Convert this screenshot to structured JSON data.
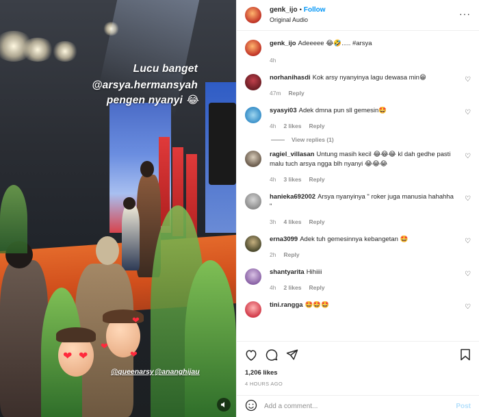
{
  "story": {
    "overlay_lines": [
      "Lucu banget",
      "@arsya.hermansyah",
      "pengen nyanyi"
    ],
    "overlay_emoji": "😂",
    "mentions": [
      "@queenarsy",
      "@ananghijau"
    ]
  },
  "header": {
    "username": "genk_ijo",
    "separator": "•",
    "follow_label": "Follow",
    "audio": "Original Audio",
    "more": "···"
  },
  "caption": {
    "username": "genk_ijo",
    "text": "Adeeeee 😂🤣..... #arsya",
    "time": "4h"
  },
  "comments": [
    {
      "username": "norhanihasdi",
      "text": "Kok arsy nyanyinya lagu dewasa min😁",
      "time": "47m",
      "likes": "",
      "reply": "Reply"
    },
    {
      "username": "syasyi03",
      "text": "Adek dmna pun sll gemesin🤩",
      "time": "4h",
      "likes": "2 likes",
      "reply": "Reply",
      "view_replies": "View replies (1)"
    },
    {
      "username": "ragiel_villasan",
      "text": "Untung masih kecil 😂😂😂 kl dah gedhe pasti malu tuch arsya ngga blh nyanyi 😂😂😂",
      "time": "4h",
      "likes": "3 likes",
      "reply": "Reply"
    },
    {
      "username": "hanieka692002",
      "text": "Arsya nyanyinya \" roker juga manusia hahahha \"",
      "time": "3h",
      "likes": "4 likes",
      "reply": "Reply"
    },
    {
      "username": "erna3099",
      "text": "Adek tuh gemesinnya kebangetan 🤩",
      "time": "2h",
      "likes": "",
      "reply": "Reply"
    },
    {
      "username": "shantyarita",
      "text": "Hihiiii",
      "time": "4h",
      "likes": "2 likes",
      "reply": "Reply"
    },
    {
      "username": "tini.rangga",
      "text": "🤩🤩🤩",
      "time": "",
      "likes": "",
      "reply": ""
    }
  ],
  "footer": {
    "likes": "1,206 likes",
    "time": "4 HOURS AGO",
    "placeholder": "Add a comment...",
    "post_label": "Post"
  }
}
